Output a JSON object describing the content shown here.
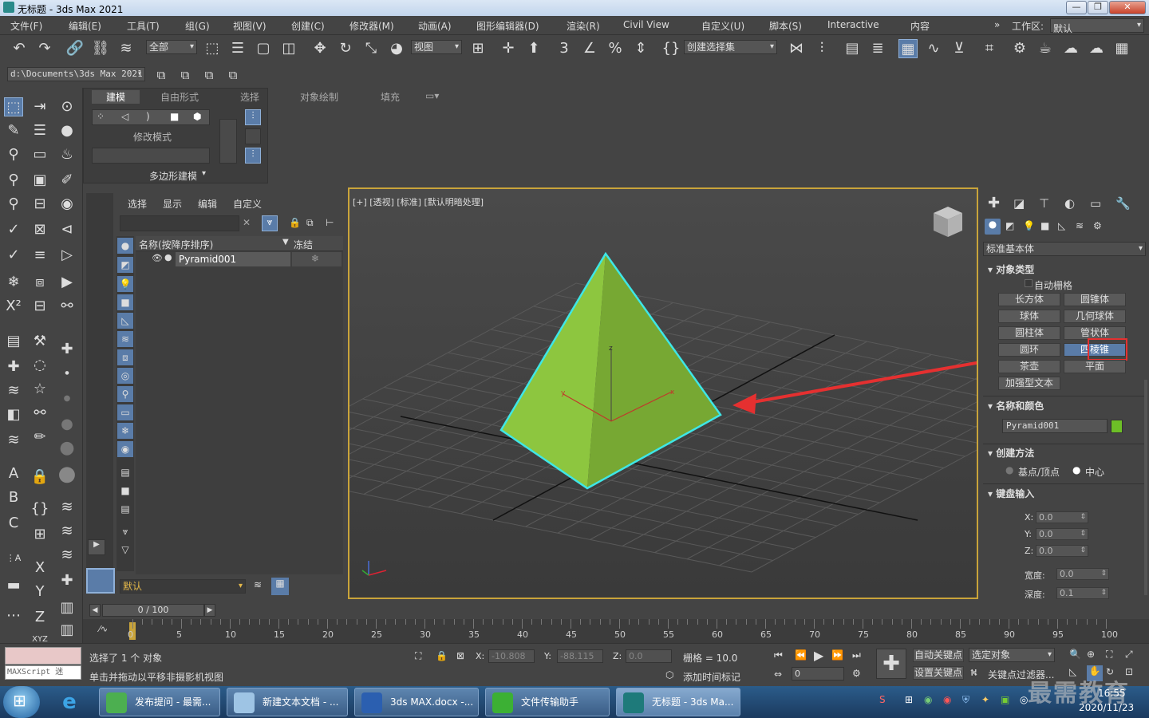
{
  "window": {
    "title": "无标题 - 3ds Max 2021"
  },
  "menu": [
    "文件(F)",
    "编辑(E)",
    "工具(T)",
    "组(G)",
    "视图(V)",
    "创建(C)",
    "修改器(M)",
    "动画(A)",
    "图形编辑器(D)",
    "渲染(R)",
    "Civil View",
    "自定义(U)",
    "脚本(S)",
    "Interactive",
    "内容"
  ],
  "workspace": {
    "label": "工作区:",
    "value": "默认"
  },
  "toolbar": {
    "filter": "全部",
    "coord": "视图",
    "selset": "创建选择集"
  },
  "path": "d:\\Documents\\3ds Max 2021",
  "ribbon": {
    "tabs": [
      "建模",
      "自由形式",
      "选择",
      "对象绘制",
      "填充"
    ],
    "modify_mode": "修改模式",
    "poly_modeling": "多边形建模"
  },
  "scene_explorer": {
    "tabs": [
      "选择",
      "显示",
      "编辑",
      "自定义"
    ],
    "col_name": "名称(按降序排序)",
    "col_freeze": "冻结",
    "items": [
      {
        "name": "Pyramid001"
      }
    ],
    "layer": "默认"
  },
  "viewport": {
    "label": "[+] [透视] [标准] [默认明暗处理]"
  },
  "command_panel": {
    "category": "标准基本体",
    "object_type": {
      "title": "对象类型",
      "autogrid": "自动栅格",
      "buttons": [
        "长方体",
        "圆锥体",
        "球体",
        "几何球体",
        "圆柱体",
        "管状体",
        "圆环",
        "四棱锥",
        "茶壶",
        "平面",
        "加强型文本"
      ],
      "highlighted": "四棱锥"
    },
    "name_color": {
      "title": "名称和颜色",
      "name": "Pyramid001",
      "color": "#6dbf27"
    },
    "creation": {
      "title": "创建方法",
      "opt1": "基点/顶点",
      "opt2": "中心",
      "selected": "中心"
    },
    "keyboard": {
      "title": "键盘输入",
      "x_label": "X:",
      "x": "0.0",
      "y_label": "Y:",
      "y": "0.0",
      "z_label": "Z:",
      "z": "0.0",
      "width_label": "宽度:",
      "width": "0.0",
      "depth_label": "深度:",
      "depth": "0.1"
    }
  },
  "timeline": {
    "slider": "0 / 100",
    "ticks": [
      "0",
      "5",
      "10",
      "15",
      "20",
      "25",
      "30",
      "35",
      "40",
      "45",
      "50",
      "55",
      "60",
      "65",
      "70",
      "75",
      "80",
      "85",
      "90",
      "95",
      "100"
    ]
  },
  "status": {
    "maxscript": "MAXScript 迷",
    "selected": "选择了 1 个 对象",
    "prompt": "单击并拖动以平移非摄影机视图",
    "x_label": "X:",
    "x": "-10.808",
    "y_label": "Y:",
    "y": "-88.115",
    "z_label": "Z:",
    "z": "0.0",
    "grid": "栅格 = 10.0",
    "add_time_tag": "添加时间标记",
    "auto_key": "自动关键点",
    "set_key": "设置关键点",
    "selected_obj": "选定对象",
    "key_filter": "关键点过滤器...",
    "frame": "0"
  },
  "taskbar": {
    "items": [
      "发布提问 - 最需...",
      "新建文本文档 - ...",
      "3ds MAX.docx -...",
      "文件传输助手",
      "无标题 - 3ds Ma..."
    ],
    "time": "16:55",
    "date": "2020/11/23",
    "watermark": "最需教育"
  },
  "colors": {
    "pyramid": "#8dc63f",
    "select_outline": "#3ee6e6",
    "arrow": "#e53030",
    "viewport_border": "#c9a43a"
  }
}
